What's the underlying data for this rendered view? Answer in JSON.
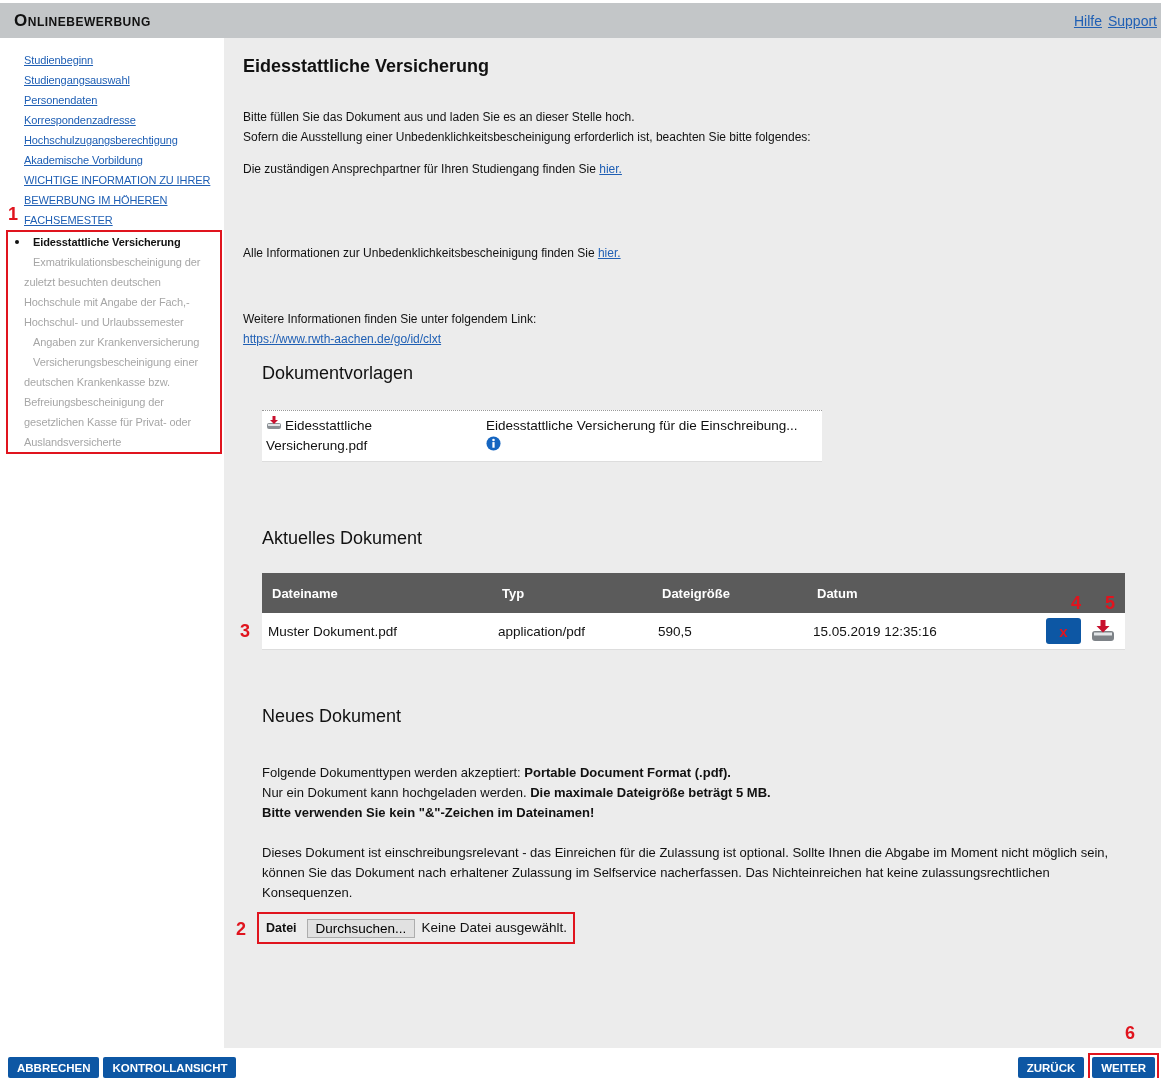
{
  "header": {
    "title": "Onlinebewerbung",
    "links": [
      "Hilfe",
      "Support"
    ]
  },
  "sidebar": {
    "items": [
      {
        "label": "Studienbeginn",
        "kind": "link"
      },
      {
        "label": "Studiengangsauswahl",
        "kind": "link"
      },
      {
        "label": "Personendaten",
        "kind": "link"
      },
      {
        "label": "Korrespondenzadresse",
        "kind": "link"
      },
      {
        "label": "Hochschulzugangsberechtigung",
        "kind": "link"
      },
      {
        "label": "Akademische Vorbildung",
        "kind": "link"
      },
      {
        "label": "WICHTIGE INFORMATION ZU IHRER BEWERBUNG IM HÖHEREN FACHSEMESTER",
        "kind": "link"
      }
    ],
    "highlight": {
      "marker": "1",
      "items": [
        {
          "label": "Eidesstattliche Versicherung",
          "kind": "current"
        },
        {
          "label": "Exmatrikulationsbescheinigung der zuletzt besuchten deutschen Hochschule mit Angabe der Fach,- Hochschul- und Urlaubssemester",
          "kind": "pending"
        },
        {
          "label": "Angaben zur Krankenversicherung",
          "kind": "pending"
        },
        {
          "label": "Versicherungsbescheinigung einer deutschen Krankenkasse bzw. Befreiungsbescheinigung der gesetzlichen Kasse für Privat- oder Auslandsversicherte",
          "kind": "pending"
        }
      ]
    }
  },
  "main": {
    "title": "Eidesstattliche Versicherung",
    "paragraphs": [
      {
        "lines": [
          "Bitte füllen Sie das Dokument aus und laden Sie es an dieser Stelle hoch.",
          "Sofern die Ausstellung einer Unbedenklichkeitsbescheinigung erforderlich ist, beachten Sie bitte folgendes:"
        ]
      },
      {
        "lines": [
          "Die zuständigen Ansprechpartner für Ihren Studiengang finden Sie"
        ],
        "link": "hier."
      },
      {
        "lines": [
          "Alle Informationen zur Unbedenklichkeitsbescheinigung finden Sie"
        ],
        "link": "hier."
      },
      {
        "lines": [
          "Weitere Informationen finden Sie unter folgendem Link:"
        ],
        "url": "https://www.rwth-aachen.de/go/id/clxt"
      }
    ],
    "templates": {
      "heading": "Dokumentvorlagen",
      "rows": [
        {
          "file": "Eidesstattliche Versicherung.pdf",
          "description": "Eidesstattliche Versicherung für die Einschreibung..."
        }
      ]
    },
    "current": {
      "heading": "Aktuelles Dokument",
      "columns": [
        "Dateiname",
        "Typ",
        "Dateigröße",
        "Datum"
      ],
      "delete_marker": "4",
      "download_marker": "5",
      "rows": [
        {
          "marker": "3",
          "cells": [
            "Muster Dokument.pdf",
            "application/pdf",
            "590,5",
            "15.05.2019 12:35:16"
          ],
          "delete": "x"
        }
      ]
    },
    "upload": {
      "heading": "Neues Dokument",
      "lines": [
        "Folgende Dokumenttypen werden akzeptiert: **Portable Document Format (.pdf).**",
        "Nur ein Dokument kann hochgeladen werden. **Die maximale Dateigröße beträgt 5 MB.**"
      ],
      "warning": "Bitte verwenden Sie kein \"&\"-Zeichen im Dateinamen!",
      "note": "Dieses Dokument ist einschreibungsrelevant - das Einreichen für die Zulassung ist optional. Sollte Ihnen die Abgabe im Moment nicht möglich sein, können Sie das Dokument nach erhaltener Zulassung im Selfservice nacherfassen. Das Nichteinreichen hat keine zulassungsrechtlichen Konsequenzen.",
      "field": {
        "marker": "2",
        "label": "Datei",
        "button": "Durchsuchen...",
        "status": "Keine Datei ausgewählt."
      }
    }
  },
  "footer": {
    "left": [
      "ABBRECHEN",
      "KONTROLLANSICHT"
    ],
    "right": [
      {
        "label": "ZURÜCK"
      },
      {
        "label": "WEITER",
        "marker": "6"
      }
    ]
  }
}
